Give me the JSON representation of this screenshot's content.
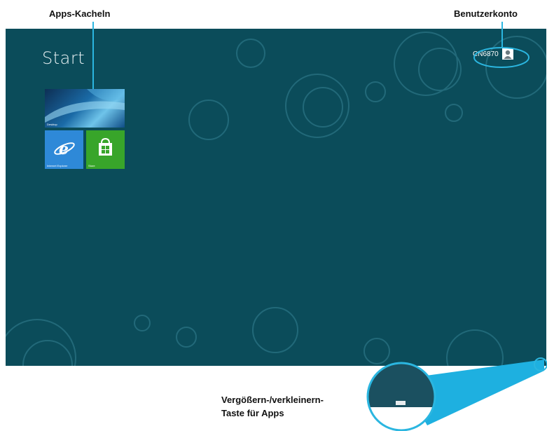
{
  "callouts": {
    "apps_tiles": "Apps-Kacheln",
    "user_account": "Benutzerkonto",
    "zoom_line1": "Vergößern-/verkleinern-",
    "zoom_line2": "Taste für Apps"
  },
  "start_screen": {
    "title": "Start",
    "background_color": "#0b4c5a",
    "account": {
      "name": "CN6870",
      "icon": "user-avatar-icon"
    },
    "tiles": [
      {
        "label": "Desktop",
        "icon": "desktop-wallpaper",
        "color": "#1a6aa6"
      },
      {
        "label": "Internet Explorer",
        "icon": "internet-explorer-icon",
        "color": "#2e89d8"
      },
      {
        "label": "Store",
        "icon": "store-bag-icon",
        "color": "#38a52a"
      }
    ]
  },
  "highlight_color": "#2bb6e0"
}
